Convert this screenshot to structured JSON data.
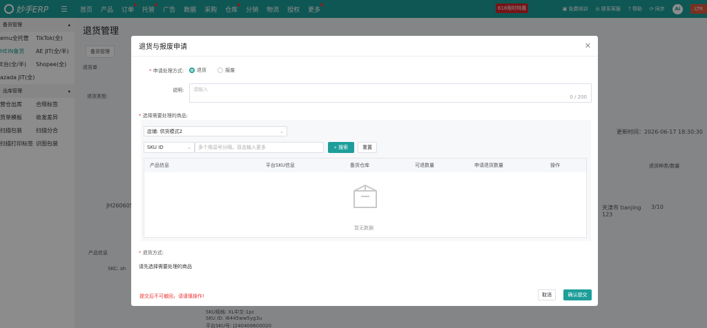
{
  "topbar": {
    "logo": "妙手ERP",
    "nav": [
      "首页",
      "产品",
      "订单",
      "托管",
      "广告",
      "数据",
      "采购",
      "仓库",
      "分销",
      "物流",
      "授权",
      "更多"
    ],
    "promo": "618限时特惠",
    "right": [
      "免费培训",
      "联系客服",
      "帮助",
      "同步"
    ],
    "ai": "Ai",
    "last": "LTR"
  },
  "sidebar": {
    "section1": "备货管理",
    "items1": [
      "emu全托管",
      "TikTok(全)",
      "HEIN备货",
      "AE JIT(全/半)",
      "E台(全/半)",
      "Shopee(全)",
      "azada JIT(全)"
    ],
    "section2": "出库管理",
    "items2": [
      "营仓出库",
      "合规标签",
      "货单模板",
      "收发差异",
      "扫描包装",
      "扫描分合",
      "扫描打印标签",
      "识图包装"
    ]
  },
  "bg": {
    "title": "退货管理",
    "tab1": "备货管理",
    "row1": "退货单",
    "row2": "退货类型:",
    "time": "更新时间：2026-06-17 18:30:30",
    "order": "JH260605",
    "addr": "天津市 tianjing 123",
    "qty": "3/10",
    "sku1": "SKC: sh",
    "sku2": "SKU规格: XL中文-1pc",
    "sku3": "SKU ID: I6445ww5yg3u",
    "sku4": "平台SKU号: J240408600020",
    "col1": "退货种类/数量",
    "prod": "产品信息"
  },
  "modal": {
    "title": "退货与报废申请",
    "method_label": "申请处理方式:",
    "opt_return": "退货",
    "opt_scrap": "报废",
    "note_label": "说明:",
    "note_placeholder": "请输入",
    "note_count": "0 / 200",
    "goods_label": "选择需要处理的商品:",
    "shop_label": "店铺:",
    "shop_value": "供货模式2",
    "sku_type": "SKU ID",
    "sku_placeholder": "多个用逗号分隔，双击输入更多",
    "search_btn": "搜索",
    "reset_btn": "重置",
    "cols": [
      "产品信息",
      "平台SKU信息",
      "备货仓库",
      "可退数量",
      "申请退货数量",
      "操作"
    ],
    "empty": "暂无数据",
    "method2_label": "退货方式:",
    "method2_hint": "请先选择需要处理的商品",
    "warn": "提交后不可撤回，请谨慎操作!",
    "cancel": "取消",
    "confirm": "确认提交"
  }
}
